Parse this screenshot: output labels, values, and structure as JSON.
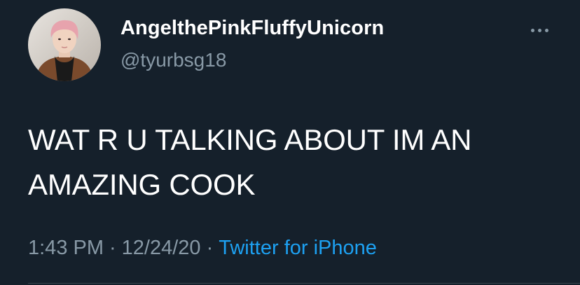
{
  "tweet": {
    "author": {
      "display_name": "AngelthePinkFluffyUnicorn",
      "handle": "@tyurbsg18"
    },
    "text": "WAT R U TALKING ABOUT IM AN AMAZING COOK",
    "time": "1:43 PM",
    "date": "12/24/20",
    "separator": "·",
    "source": "Twitter for iPhone",
    "more_icon": "more-horizontal-icon"
  },
  "colors": {
    "background": "#15202b",
    "primary_text": "#ffffff",
    "secondary_text": "#8899a6",
    "link": "#1da1f2",
    "divider": "#38444d"
  }
}
